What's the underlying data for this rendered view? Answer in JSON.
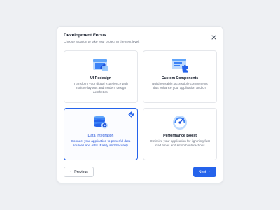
{
  "dialog": {
    "title": "Development Focus",
    "subtitle": "Choose a option to take your project to the next level.",
    "close_icon": "close-icon"
  },
  "options": [
    {
      "title": "UI Redesign",
      "description": "Transform your digital experience with intuitive layouts and modern design aesthetics.",
      "icon": "ui-redesign-icon",
      "selected": false
    },
    {
      "title": "Custom Components",
      "description": "Build reusable, accessible components that enhance your application and UI.",
      "icon": "custom-components-icon",
      "selected": false
    },
    {
      "title": "Data Integration",
      "description": "Connect your application to powerful data sources and APIs. Easily and Securely.",
      "icon": "data-integration-icon",
      "selected": true
    },
    {
      "title": "Performance Boost",
      "description": "Optimize your application for lightning-fast load times and smooth interactions",
      "icon": "performance-gauge-icon",
      "selected": false
    }
  ],
  "footer": {
    "previous_label": "Previous",
    "next_label": "Next",
    "previous_arrow": "←",
    "next_arrow": "→"
  },
  "colors": {
    "accent": "#2563eb",
    "accent_light": "#dbeafe",
    "icon_light": "#bfdbfe",
    "page_background": "#eef0f3"
  }
}
